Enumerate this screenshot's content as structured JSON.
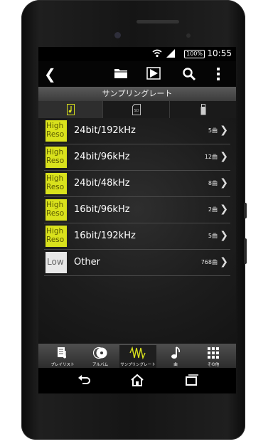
{
  "status": {
    "battery": "100%",
    "time": "10:55"
  },
  "toolbar": {
    "back_icon": "chevron-left-icon",
    "folder_icon": "folder-icon",
    "play_icon": "play-icon",
    "search_icon": "search-icon",
    "menu_icon": "overflow-menu-icon"
  },
  "title": "サンプリングレート",
  "source_tabs": [
    {
      "icon": "music-note-icon",
      "selected": true
    },
    {
      "icon": "sd-card-icon",
      "selected": false
    },
    {
      "icon": "usb-icon",
      "selected": false
    }
  ],
  "rows": [
    {
      "badge": [
        "High",
        "Reso"
      ],
      "type": "high",
      "label": "24bit/192kHz",
      "count": "5曲"
    },
    {
      "badge": [
        "High",
        "Reso"
      ],
      "type": "high",
      "label": "24bit/96kHz",
      "count": "12曲"
    },
    {
      "badge": [
        "High",
        "Reso"
      ],
      "type": "high",
      "label": "24bit/48kHz",
      "count": "8曲"
    },
    {
      "badge": [
        "High",
        "Reso"
      ],
      "type": "high",
      "label": "16bit/96kHz",
      "count": "2曲"
    },
    {
      "badge": [
        "High",
        "Reso"
      ],
      "type": "high",
      "label": "16bit/192kHz",
      "count": "5曲"
    },
    {
      "badge": [
        "Low"
      ],
      "type": "low",
      "label": "Other",
      "count": "768曲"
    }
  ],
  "bottom_tabs": [
    {
      "label": "プレイリスト",
      "icon": "playlist-icon",
      "selected": false
    },
    {
      "label": "アルバム",
      "icon": "album-icon",
      "selected": false
    },
    {
      "label": "サンプリングレート",
      "icon": "waveform-icon",
      "selected": true
    },
    {
      "label": "曲",
      "icon": "music-note-icon",
      "selected": false
    },
    {
      "label": "その他",
      "icon": "grid-icon",
      "selected": false
    }
  ],
  "navbar": {
    "back_icon": "back-icon",
    "home_icon": "home-icon",
    "recents_icon": "recents-icon"
  },
  "colors": {
    "accent": "#d9e11c",
    "background": "#1d1d1d"
  }
}
